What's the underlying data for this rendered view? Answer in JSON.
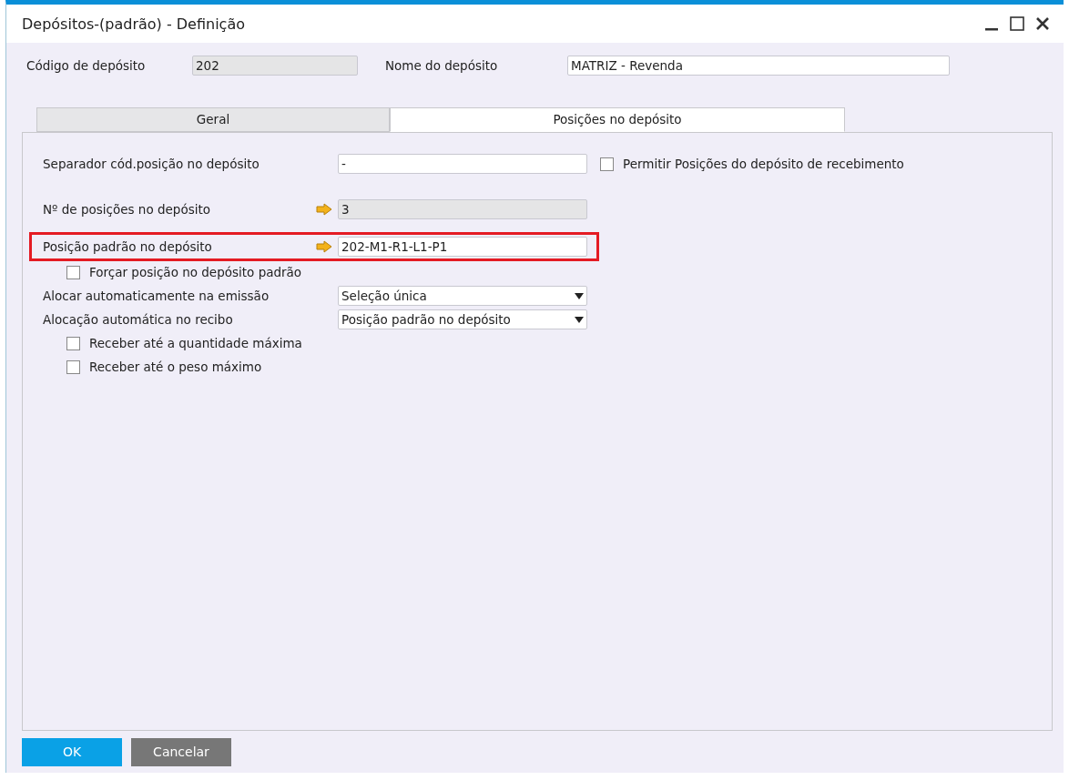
{
  "window": {
    "title": "Depósitos-(padrão) - Definição"
  },
  "header": [
    {
      "label": "Código de depósito",
      "value": "202",
      "readonly": true
    },
    {
      "label": "Nome do depósito",
      "value": "MATRIZ - Revenda",
      "readonly": false
    }
  ],
  "tabs": [
    {
      "label": "Geral",
      "selected": false
    },
    {
      "label": "Posições no depósito",
      "selected": true
    }
  ],
  "rows": [
    {
      "kind": "text",
      "label": "Separador cód.posição no depósito",
      "value": "-",
      "readonly": false,
      "link_arrow": false,
      "highlighted": false,
      "side_checkbox": {
        "label": "Permitir Posições do depósito de recebimento",
        "checked": false
      }
    },
    {
      "kind": "text",
      "label": "Nº de posições no depósito",
      "value": "3",
      "readonly": true,
      "link_arrow": true,
      "highlighted": false
    },
    {
      "kind": "text",
      "label": "Posição padrão no depósito",
      "value": "202-M1-R1-L1-P1",
      "readonly": false,
      "link_arrow": true,
      "highlighted": true
    },
    {
      "kind": "checkbox",
      "label": "Forçar posição no depósito padrão",
      "checked": false
    },
    {
      "kind": "dropdown",
      "label": "Alocar automaticamente na emissão",
      "value": "Seleção única"
    },
    {
      "kind": "dropdown",
      "label": "Alocação automática no recibo",
      "value": "Posição padrão no depósito"
    },
    {
      "kind": "checkbox",
      "label": "Receber até a quantidade máxima",
      "checked": false
    },
    {
      "kind": "checkbox",
      "label": "Receber até o peso máximo",
      "checked": false
    }
  ],
  "buttons": [
    {
      "label": "OK",
      "kind": "primary"
    },
    {
      "label": "Cancelar",
      "kind": "secondary"
    }
  ]
}
